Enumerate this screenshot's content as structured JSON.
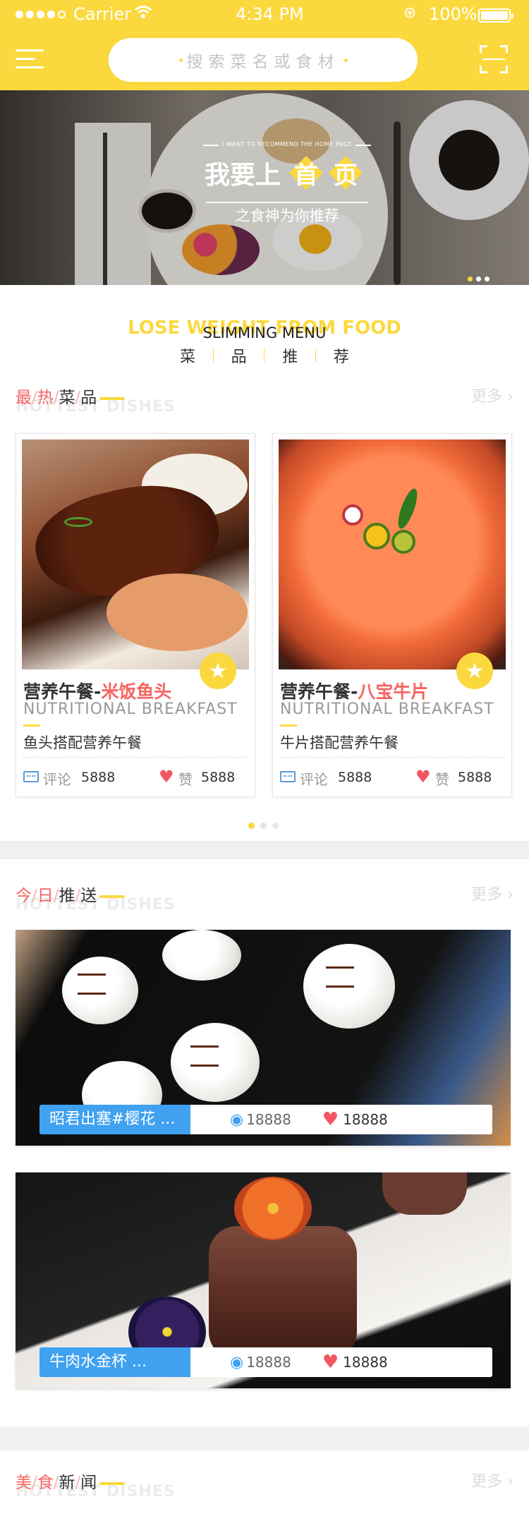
{
  "status_bar": {
    "carrier": "Carrier",
    "time": "4:34 PM",
    "battery": "100%"
  },
  "header": {
    "search_placeholder": "搜索菜名或食材"
  },
  "banner": {
    "subtitle_en": "I WANT TO RECOMMEND THE HOME PAGE",
    "title_plain": "我要上",
    "title_hl1": "首",
    "title_hl2": "页",
    "slogan": "之食神为你推荐",
    "active_slide": 1,
    "slides": 3
  },
  "slimming_menu": {
    "en_bg": "LOSE WEIGHT FROM FOOD",
    "en": "SLIMMING MENU",
    "cn": [
      "菜",
      "品",
      "推",
      "荐"
    ]
  },
  "hottest": {
    "t1": "最",
    "s1": "/",
    "t2": "热",
    "s2": "/",
    "t3": "菜",
    "s3": "/",
    "t4": "品",
    "ghost": "HOTTEST DISHES",
    "more": "更多"
  },
  "dishes": [
    {
      "name_prefix": "营养午餐-",
      "name_hl": "米饭鱼头",
      "name_en": "NUTRITIONAL BREAKFAST",
      "desc": "鱼头搭配营养午餐",
      "comment_label": "评论",
      "comments": "5888",
      "like_label": "赞",
      "likes": "5888"
    },
    {
      "name_prefix": "营养午餐-",
      "name_hl": "八宝牛片",
      "name_en": "NUTRITIONAL BREAKFAST",
      "desc": "牛片搭配营养午餐",
      "comment_label": "评论",
      "comments": "5888",
      "like_label": "赞",
      "likes": "5888"
    }
  ],
  "dishes_pager": {
    "active": 1,
    "count": 3
  },
  "today": {
    "t1": "今",
    "s1": "/",
    "t2": "日",
    "s2": "/",
    "t3": "推",
    "s3": "/",
    "t4": "送",
    "ghost": "HOTTEST DISHES",
    "more": "更多"
  },
  "recommendations": [
    {
      "title": "昭君出塞#樱花 ...",
      "views": "18888",
      "likes": "18888"
    },
    {
      "title": "牛肉水金杯 ...",
      "views": "18888",
      "likes": "18888"
    }
  ],
  "news": {
    "t1": "美",
    "s1": "/",
    "t2": "食",
    "s2": "/",
    "t3": "新",
    "s3": "/",
    "t4": "闻",
    "ghost": "HOTTEST DISHES",
    "more": "更多"
  },
  "colors": {
    "brand_yellow": "#fbd93e",
    "accent_red": "#f56562",
    "blue": "#3fa1f0"
  },
  "icons": {
    "menu": "hamburger-icon",
    "scan": "scan-icon",
    "wifi": "wifi-icon",
    "badge": "star-icon",
    "comment": "comment-icon",
    "like": "heart-icon",
    "view": "eye-icon",
    "more": "chevron-right-icon"
  }
}
